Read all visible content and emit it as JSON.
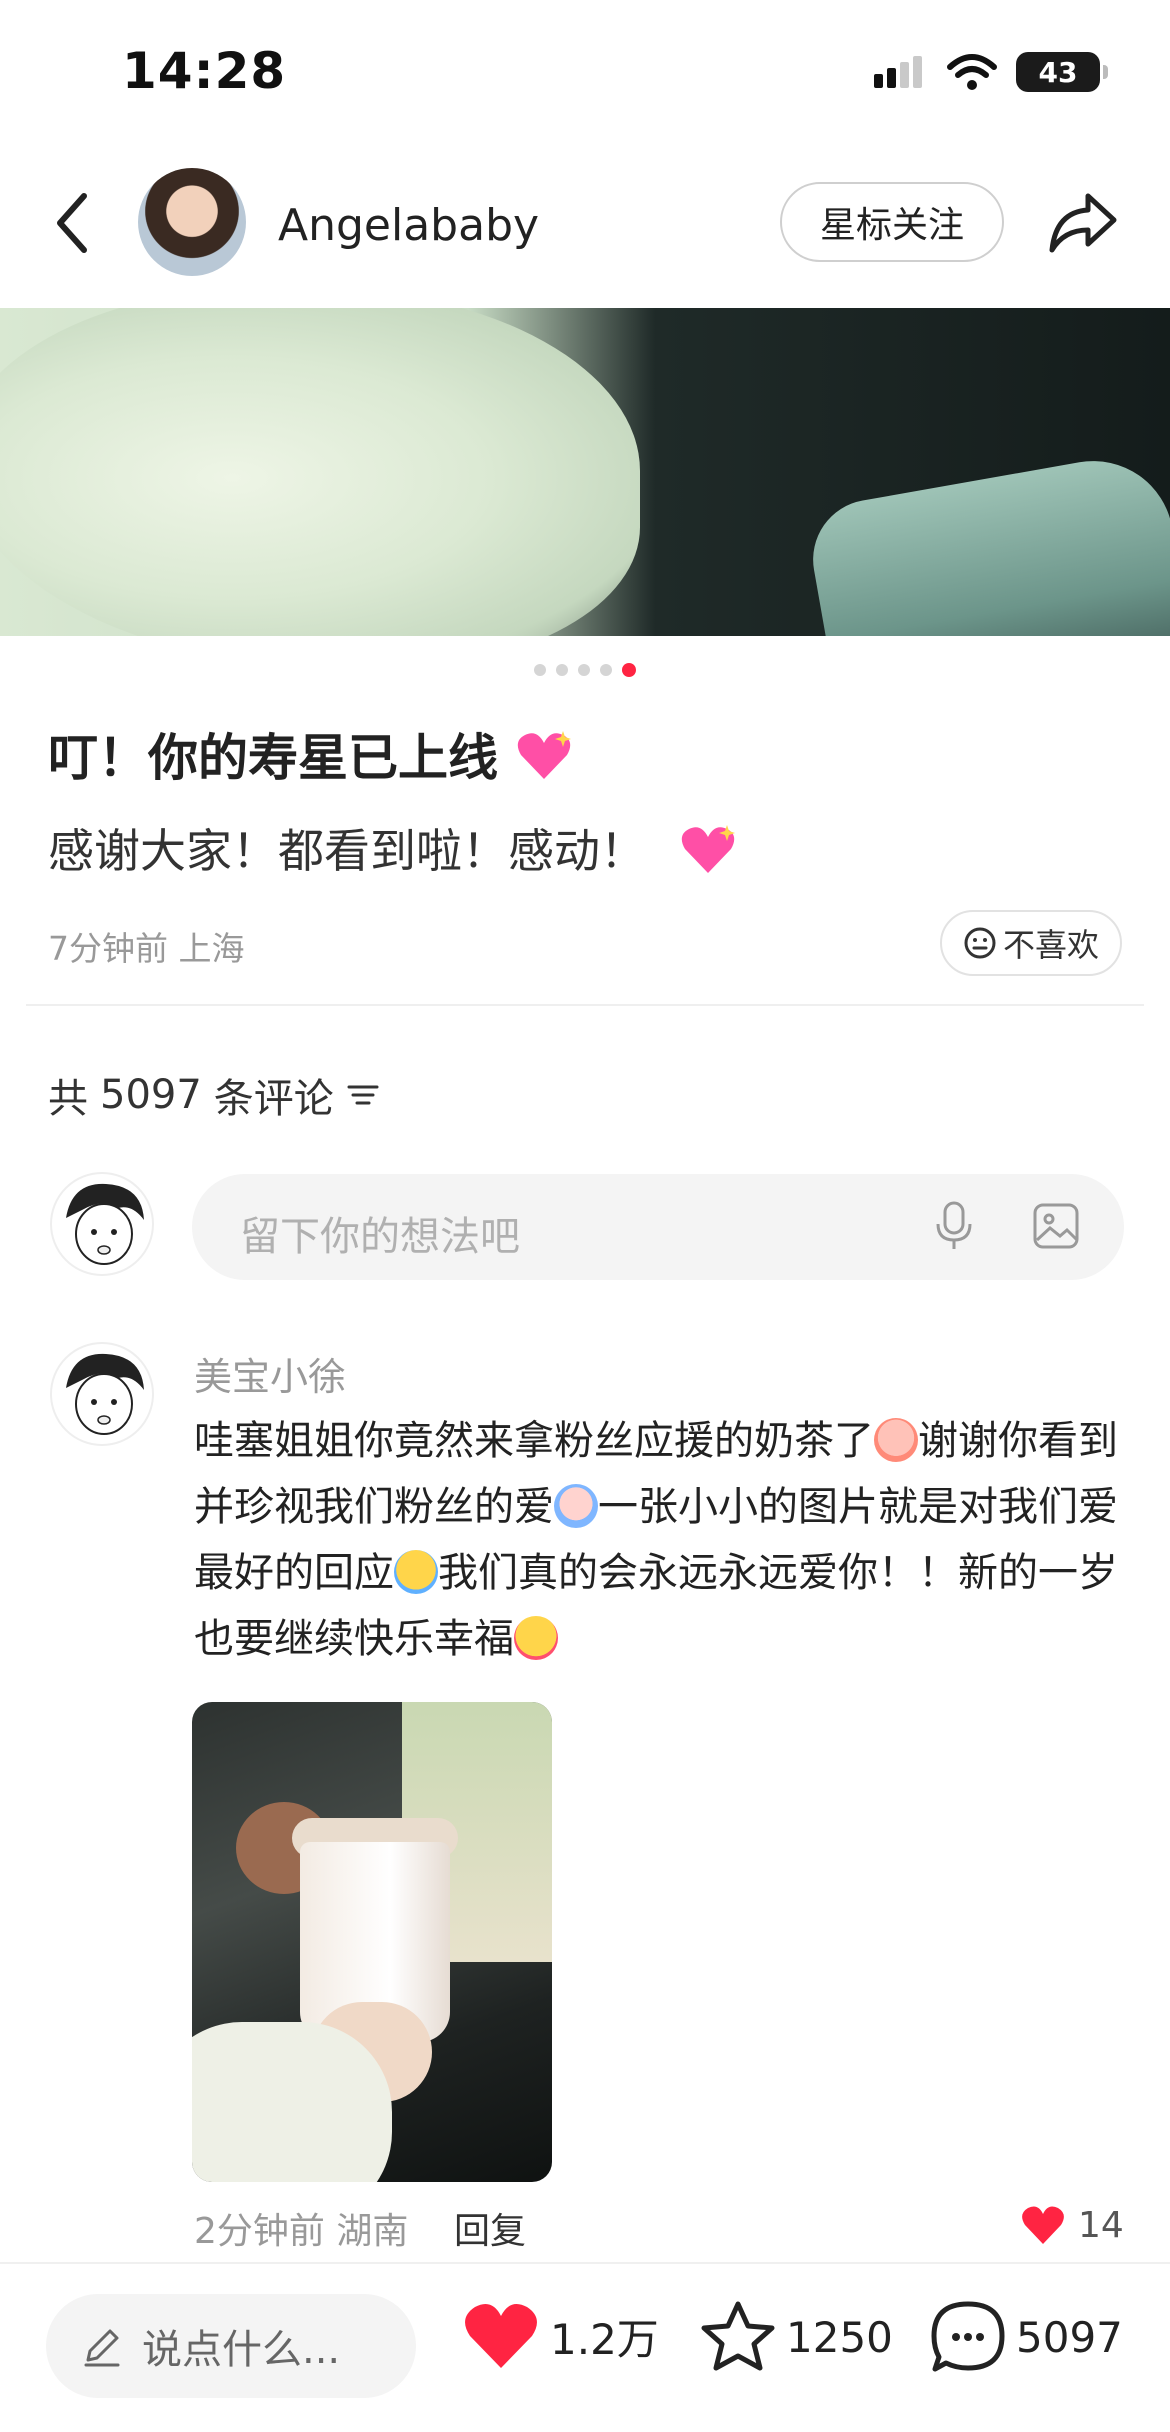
{
  "status_bar": {
    "time": "14:28",
    "battery": "43"
  },
  "header": {
    "author": "Angelababy",
    "follow_label": "星标关注"
  },
  "carousel": {
    "total": 5,
    "active_index": 4
  },
  "post": {
    "title": "叮！你的寿星已上线",
    "body": "感谢大家！都看到啦！感动！",
    "meta": "7分钟前 上海",
    "dislike_label": "不喜欢"
  },
  "comments_header": {
    "prefix": "共",
    "count": "5097",
    "suffix": "条评论"
  },
  "comment_input": {
    "placeholder": "留下你的想法吧"
  },
  "comment": {
    "user": "美宝小徐",
    "text_1": "哇塞姐姐你竟然来拿粉丝应援的奶茶了",
    "text_2": "谢谢你看到并珍视我们粉丝的爱",
    "text_3": "一张小小的图片就是对我们爱最好的回应",
    "text_4": "我们真的会永远永远爱你！！新的一岁也要继续快乐幸福",
    "meta": "2分钟前 湖南",
    "reply_label": "回复",
    "likes": "14"
  },
  "bottom_bar": {
    "say_placeholder": "说点什么...",
    "likes": "1.2万",
    "collects": "1250",
    "comments": "5097"
  },
  "colors": {
    "accent": "#ff2442"
  },
  "icons": [
    "back-arrow-icon",
    "share-icon",
    "heart-sparkle-icon",
    "neutral-face-icon",
    "filter-icon",
    "mic-icon",
    "image-icon",
    "heart-icon",
    "star-icon",
    "comment-bubble-icon",
    "pencil-icon"
  ]
}
